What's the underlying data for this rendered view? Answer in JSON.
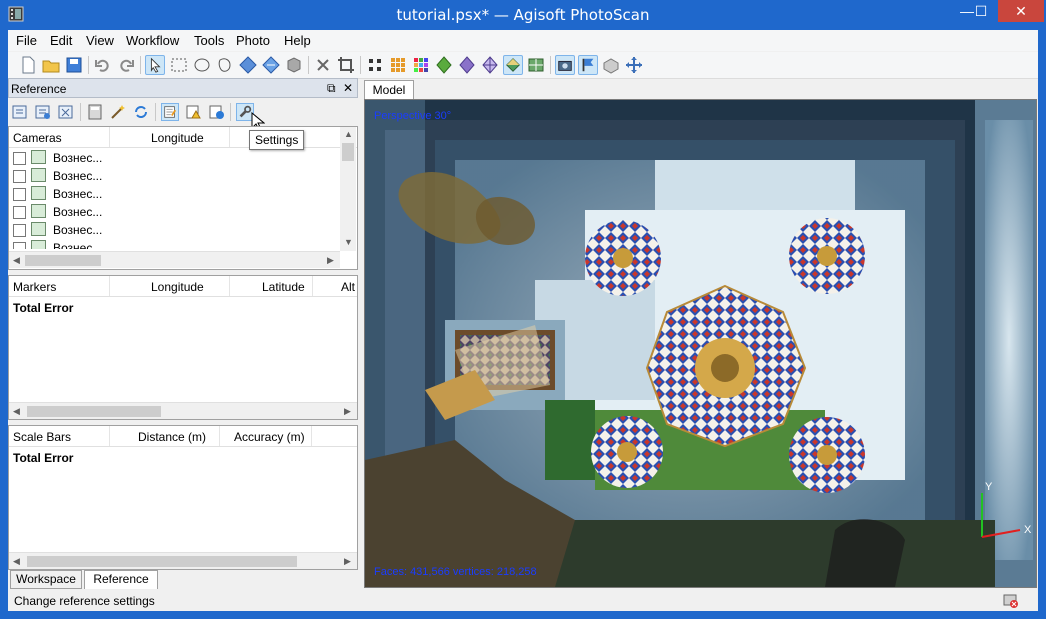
{
  "window": {
    "title": "tutorial.psx* — Agisoft PhotoScan",
    "minimize": "—",
    "maximize": "☐",
    "close": "✕"
  },
  "menu": [
    "File",
    "Edit",
    "View",
    "Workflow",
    "Tools",
    "Photo",
    "Help"
  ],
  "reference_panel": {
    "title": "Reference",
    "float_icon": "⧉",
    "close_icon": "✕",
    "tooltip": "Settings",
    "cameras": {
      "headers": [
        "Cameras",
        "Longitude"
      ],
      "rows": [
        "Вознес...",
        "Вознес...",
        "Вознес...",
        "Вознес...",
        "Вознес...",
        "Вознес..."
      ]
    },
    "markers": {
      "headers": [
        "Markers",
        "Longitude",
        "Latitude",
        "Alt"
      ],
      "total": "Total Error"
    },
    "scalebars": {
      "headers": [
        "Scale Bars",
        "Distance (m)",
        "Accuracy (m)"
      ],
      "total": "Total Error"
    }
  },
  "tabs": [
    "Workspace",
    "Reference"
  ],
  "status_text": "Change reference settings",
  "viewport": {
    "tab": "Model",
    "perspective": "Perspective 30°",
    "stats": "Faces: 431,566 vertices: 218,258"
  },
  "axes": {
    "x": "X",
    "y": "Y"
  },
  "colors": {
    "titlebar": "#1f68cc",
    "accent": "#cde6f7",
    "sky": "#233b53"
  }
}
